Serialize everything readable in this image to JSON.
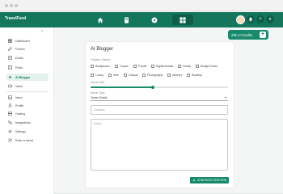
{
  "brand": {
    "name": "TravelFeed"
  },
  "colors": {
    "primary": "#14765c",
    "accent": "#178a6c",
    "active_bg": "#e4f1ed"
  },
  "topnav": {
    "icons": [
      "home-icon",
      "book-icon",
      "compass-icon",
      "grid-icon"
    ],
    "active": "grid-icon",
    "right_icons": [
      "bell-icon",
      "plus-icon",
      "chevron-down-icon"
    ]
  },
  "sidebar": {
    "items_main": [
      {
        "label": "Dashboard",
        "icon": "dashboard-icon"
      },
      {
        "label": "Publish",
        "icon": "pencil-icon"
      },
      {
        "label": "Drafts",
        "icon": "draft-icon"
      },
      {
        "label": "Posts",
        "icon": "posts-icon"
      },
      {
        "label": "Locations",
        "icon": "location-icon"
      },
      {
        "label": "AI Blogger",
        "icon": "ai-blogger-icon",
        "active": true
      },
      {
        "label": "Video",
        "icon": "video-icon"
      }
    ],
    "items_account": [
      {
        "label": "Inbox",
        "icon": "inbox-icon"
      },
      {
        "label": "Profile",
        "icon": "user-icon"
      },
      {
        "label": "Hosting",
        "icon": "hosting-icon"
      },
      {
        "label": "Integrations",
        "icon": "integrations-icon"
      },
      {
        "label": "Settings",
        "icon": "gear-icon"
      },
      {
        "label": "Refer a friend",
        "icon": "refer-icon"
      }
    ]
  },
  "credits": {
    "label": "20k AI Credits",
    "add": "+"
  },
  "card": {
    "title": "AI Blogger",
    "traveler_types_label": "Traveler Type(s)",
    "traveler_types": [
      "Backpacker",
      "Couple",
      "Foodie",
      "Digital Nomad",
      "Family",
      "Budget Travel",
      "Luxury",
      "Hike",
      "Camper",
      "Photography",
      "Itinerary",
      "Roadtrip"
    ],
    "words_label": "Words: 800",
    "words_fraction": 0.45,
    "article_type_label": "Article Type",
    "article_type_value": "Travel Guide",
    "location_placeholder": "Location",
    "notes_placeholder": "Notes",
    "generate_label": "GENERATE PREVIEW"
  }
}
